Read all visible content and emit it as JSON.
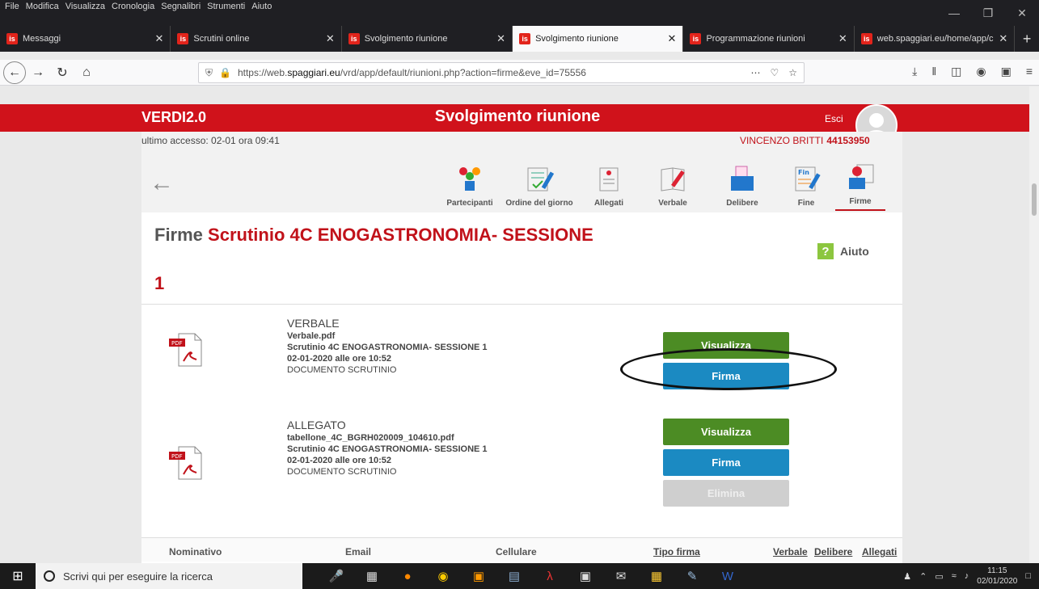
{
  "menu": [
    "File",
    "Modifica",
    "Visualizza",
    "Cronologia",
    "Segnalibri",
    "Strumenti",
    "Aiuto"
  ],
  "tabs": [
    {
      "label": "Messaggi",
      "active": false
    },
    {
      "label": "Scrutini online",
      "active": false
    },
    {
      "label": "Svolgimento riunione",
      "active": false
    },
    {
      "label": "Svolgimento riunione",
      "active": true
    },
    {
      "label": "Programmazione riunioni",
      "active": false
    },
    {
      "label": "web.spaggiari.eu/home/app/c",
      "active": false
    }
  ],
  "favicon_text": "is",
  "url": {
    "prefix": "https://web.",
    "domain": "spaggiari.eu",
    "path": "/vrd/app/default/riunioni.php?action=firme&eve_id=75556"
  },
  "app": {
    "logo": "VERDI2.0",
    "title": "Svolgimento riunione",
    "logout": "Esci",
    "last_access": "ultimo accesso: 02-01 ora 09:41",
    "user_name": "VINCENZO BRITTI",
    "user_id": "44153950"
  },
  "nav_items": [
    {
      "label": "Partecipanti",
      "icon": "participants-icon"
    },
    {
      "label": "Ordine del giorno",
      "icon": "agenda-icon"
    },
    {
      "label": "Allegati",
      "icon": "attachments-icon"
    },
    {
      "label": "Verbale",
      "icon": "minutes-icon"
    },
    {
      "label": "Delibere",
      "icon": "resolutions-icon"
    },
    {
      "label": "Fine",
      "icon": "end-icon"
    },
    {
      "label": "Firme",
      "icon": "signatures-icon"
    }
  ],
  "heading": {
    "prefix": "Firme",
    "title": "Scrutinio 4C ENOGASTRONOMIA- SESSIONE",
    "title_line2": "1"
  },
  "help_label": "Aiuto",
  "documents": [
    {
      "type": "VERBALE",
      "filename": "Verbale.pdf",
      "session": "Scrutinio 4C ENOGASTRONOMIA- SESSIONE 1",
      "date": "02-01-2020 alle ore 10:52",
      "category": "DOCUMENTO SCRUTINIO",
      "buttons": [
        "Visualizza",
        "Firma"
      ]
    },
    {
      "type": "ALLEGATO",
      "filename": "tabellone_4C_BGRH020009_104610.pdf",
      "session": "Scrutinio 4C ENOGASTRONOMIA- SESSIONE 1",
      "date": "02-01-2020 alle ore 10:52",
      "category": "DOCUMENTO SCRUTINIO",
      "buttons": [
        "Visualizza",
        "Firma",
        "Elimina"
      ]
    }
  ],
  "table_headers": [
    "Nominativo",
    "Email",
    "Cellulare",
    "Tipo firma",
    "Verbale",
    "Delibere",
    "Allegati"
  ],
  "pdf_badge": "PDF",
  "taskbar": {
    "search_placeholder": "Scrivi qui per eseguire la ricerca",
    "time": "11:15",
    "date": "02/01/2020"
  }
}
